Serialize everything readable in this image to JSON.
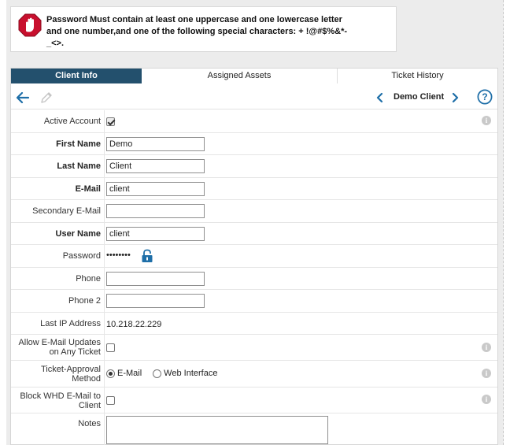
{
  "alert": {
    "icon": "stop-hand-icon",
    "line1": "Password Must contain at least one uppercase and one lowercase letter",
    "line2": "and one number,and one of the following special characters: + !@#$%&*-",
    "line3": "_<>."
  },
  "tabs": [
    {
      "label": "Client Info",
      "active": true
    },
    {
      "label": "Assigned Assets",
      "active": false
    },
    {
      "label": "Ticket History",
      "active": false
    }
  ],
  "toolbar": {
    "back_icon": "back-arrow-icon",
    "edit_icon": "pencil-icon",
    "client_name": "Demo Client",
    "help_icon": "help-icon"
  },
  "form": {
    "active_account": {
      "label": "Active Account",
      "checked": true
    },
    "first_name": {
      "label": "First Name",
      "value": "Demo"
    },
    "last_name": {
      "label": "Last Name",
      "value": "Client"
    },
    "email": {
      "label": "E-Mail",
      "value": "client"
    },
    "secondary_email": {
      "label": "Secondary E-Mail",
      "value": ""
    },
    "user_name": {
      "label": "User Name",
      "value": "client"
    },
    "password": {
      "label": "Password",
      "value": "••••••••"
    },
    "phone": {
      "label": "Phone",
      "value": ""
    },
    "phone2": {
      "label": "Phone 2",
      "value": ""
    },
    "last_ip": {
      "label": "Last IP Address",
      "value": "10.218.22.229"
    },
    "allow_email_updates": {
      "label_line1": "Allow E-Mail Updates",
      "label_line2": "on Any Ticket",
      "checked": false
    },
    "ticket_approval": {
      "label_line1": "Ticket-Approval",
      "label_line2": "Method",
      "option_email": "E-Mail",
      "option_web": "Web Interface",
      "selected": "E-Mail"
    },
    "block_whd": {
      "label_line1": "Block WHD E-Mail to",
      "label_line2": "Client",
      "checked": false
    },
    "notes": {
      "label": "Notes",
      "value": ""
    }
  },
  "colors": {
    "tab_active": "#23506d",
    "accent": "#1f6fa8",
    "alert_red": "#c8102e"
  }
}
